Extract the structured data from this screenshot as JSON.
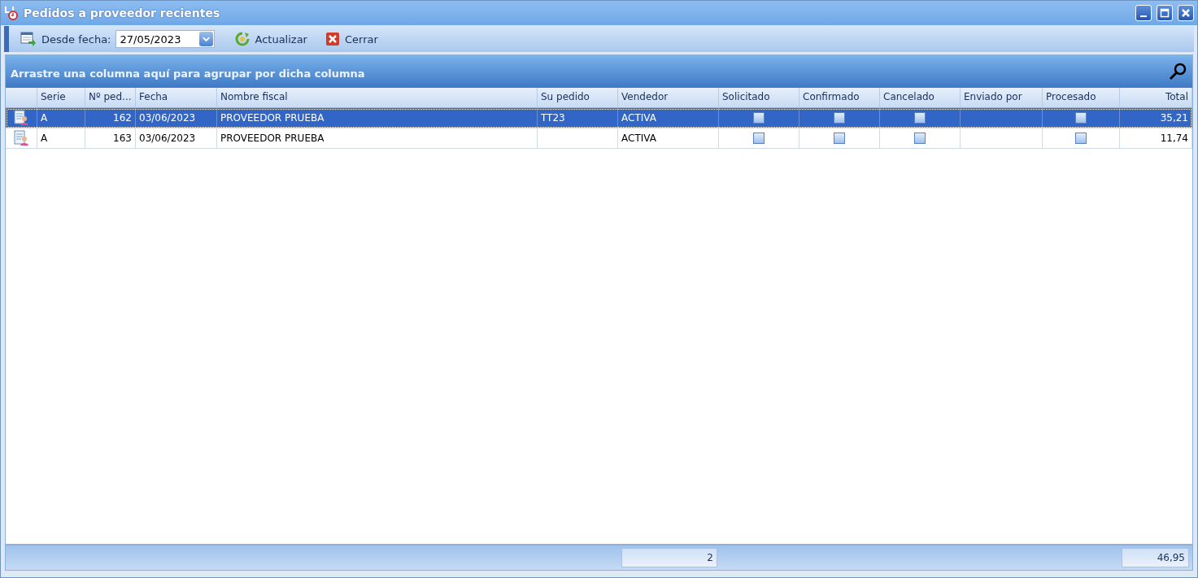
{
  "window": {
    "title": "Pedidos a proveedor recientes"
  },
  "toolbar": {
    "date_label": "Desde fecha:",
    "date_value": "27/05/2023",
    "buttons": [
      {
        "label": "Actualizar",
        "kind": "refresh"
      },
      {
        "label": "Cerrar",
        "kind": "close"
      }
    ]
  },
  "group_panel": {
    "hint": "Arrastre una columna aquí para agrupar por dicha columna"
  },
  "table": {
    "columns": [
      "Serie",
      "Nº ped...",
      "Fecha",
      "Nombre fiscal",
      "Su pedido",
      "Vendedor",
      "Solicitado",
      "Confirmado",
      "Cancelado",
      "Enviado por",
      "Procesado",
      "Total"
    ],
    "rows": [
      {
        "selected": true,
        "serie": "A",
        "numero": "162",
        "fecha": "03/06/2023",
        "nombre": "PROVEEDOR PRUEBA",
        "su_pedido": "TT23",
        "vendedor": "ACTIVA",
        "solicitado": false,
        "confirmado": false,
        "cancelado": false,
        "procesado": false,
        "total": "35,21"
      },
      {
        "selected": false,
        "serie": "A",
        "numero": "163",
        "fecha": "03/06/2023",
        "nombre": "PROVEEDOR PRUEBA",
        "vendedor": "ACTIVA",
        "solicitado": false,
        "confirmado": false,
        "cancelado": false,
        "procesado": false,
        "total": "11,74"
      }
    ]
  },
  "footer": {
    "count": "2",
    "total": "46,95"
  }
}
